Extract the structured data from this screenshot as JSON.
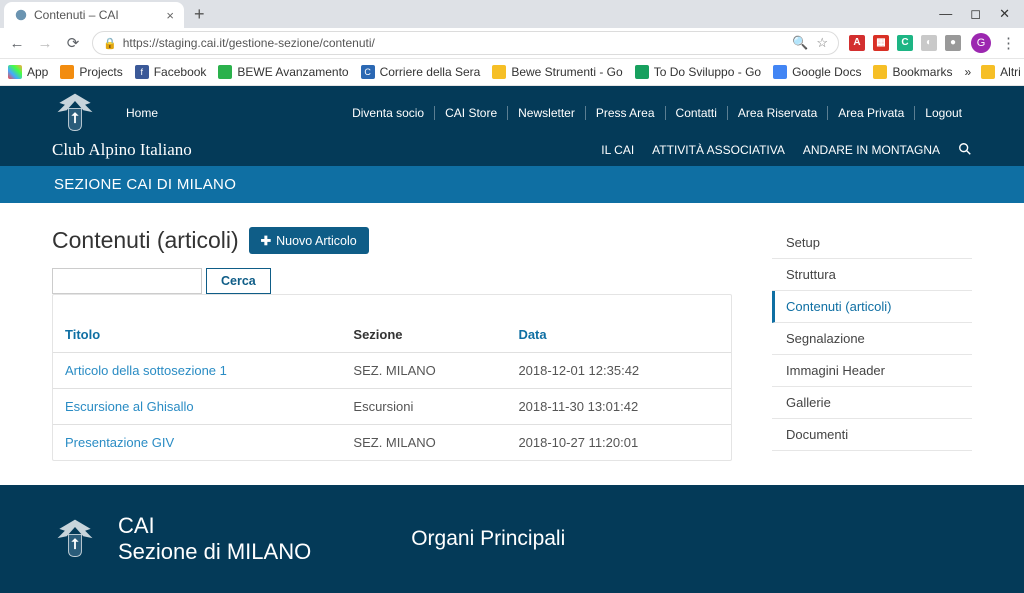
{
  "browser": {
    "tab_title": "Contenuti – CAI",
    "url_display": "https://staging.cai.it/gestione-sezione/contenuti/",
    "bookmarks": [
      {
        "label": "App",
        "color": "#f0b400"
      },
      {
        "label": "Projects",
        "color": "#f28c0f"
      },
      {
        "label": "Facebook",
        "color": "#3b5998"
      },
      {
        "label": "BEWE Avanzamento",
        "color": "#2bb14c"
      },
      {
        "label": "Corriere della Sera",
        "color": "#2b68b3"
      },
      {
        "label": "Bewe Strumenti - Go",
        "color": "#f6bf26"
      },
      {
        "label": "To Do Sviluppo - Go",
        "color": "#17a05e"
      },
      {
        "label": "Google Docs",
        "color": "#4285f4"
      },
      {
        "label": "Bookmarks",
        "color": "#f6bf26"
      }
    ],
    "bookmark_overflow": "»",
    "bookmark_last": "Altri Preferiti",
    "avatar_initial": "G"
  },
  "utility_nav": {
    "home": "Home",
    "items": [
      "Diventa socio",
      "CAI Store",
      "Newsletter",
      "Press Area",
      "Contatti",
      "Area Riservata",
      "Area Privata",
      "Logout"
    ]
  },
  "site_title": "Club Alpino Italiano",
  "main_nav": [
    "IL CAI",
    "ATTIVITÀ ASSOCIATIVA",
    "ANDARE IN MONTAGNA"
  ],
  "sub_header": "SEZIONE CAI DI MILANO",
  "page": {
    "title": "Contenuti (articoli)",
    "new_button": "Nuovo Articolo",
    "search_button": "Cerca",
    "search_value": "",
    "table": {
      "headers": {
        "titolo": "Titolo",
        "sezione": "Sezione",
        "data": "Data"
      },
      "rows": [
        {
          "titolo": "Articolo della sottosezione 1",
          "sezione": "SEZ. MILANO",
          "data": "2018-12-01 12:35:42"
        },
        {
          "titolo": "Escursione al Ghisallo",
          "sezione": "Escursioni",
          "data": "2018-11-30 13:01:42"
        },
        {
          "titolo": "Presentazione GIV",
          "sezione": "SEZ. MILANO",
          "data": "2018-10-27 11:20:01"
        }
      ]
    }
  },
  "side_nav": [
    {
      "label": "Setup",
      "active": false
    },
    {
      "label": "Struttura",
      "active": false
    },
    {
      "label": "Contenuti (articoli)",
      "active": true
    },
    {
      "label": "Segnalazione",
      "active": false
    },
    {
      "label": "Immagini Header",
      "active": false
    },
    {
      "label": "Gallerie",
      "active": false
    },
    {
      "label": "Documenti",
      "active": false
    }
  ],
  "footer": {
    "title1": "CAI",
    "title2": "Sezione di MILANO",
    "mid": "Organi Principali"
  }
}
